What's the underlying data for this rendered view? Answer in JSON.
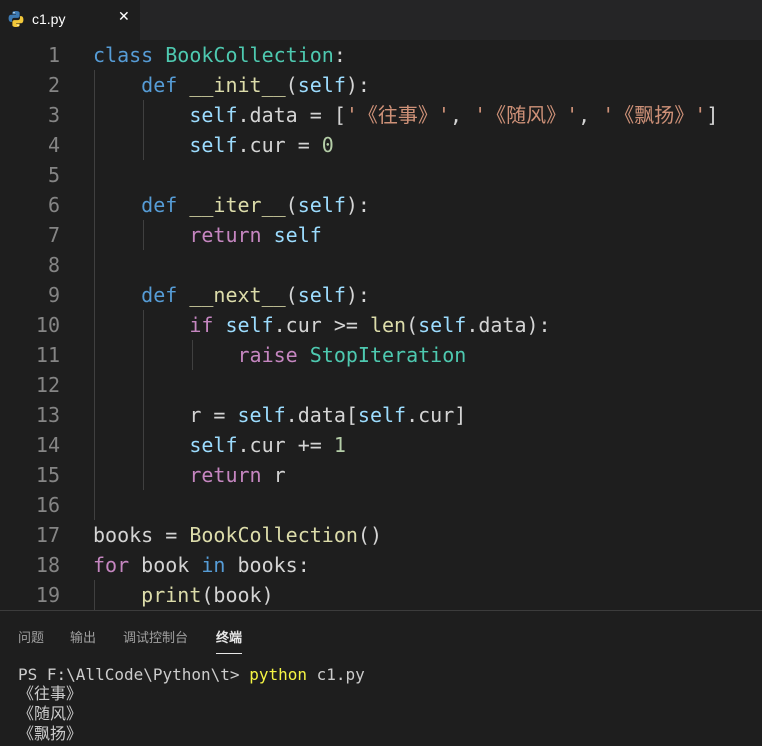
{
  "tab": {
    "filename": "c1.py",
    "close_glyph": "✕",
    "icon": "python-icon"
  },
  "editor": {
    "lines": [
      {
        "n": "1",
        "tokens": [
          [
            "kw",
            "class"
          ],
          [
            "txt",
            " "
          ],
          [
            "cls",
            "BookCollection"
          ],
          [
            "txt",
            ":"
          ]
        ]
      },
      {
        "n": "2",
        "tokens": [
          [
            "txt",
            "    "
          ],
          [
            "kw",
            "def"
          ],
          [
            "txt",
            " "
          ],
          [
            "fn",
            "__init__"
          ],
          [
            "txt",
            "("
          ],
          [
            "var",
            "self"
          ],
          [
            "txt",
            "):"
          ]
        ]
      },
      {
        "n": "3",
        "tokens": [
          [
            "txt",
            "        "
          ],
          [
            "var",
            "self"
          ],
          [
            "txt",
            ".data = ["
          ],
          [
            "str",
            "'《往事》'"
          ],
          [
            "txt",
            ", "
          ],
          [
            "str",
            "'《随风》'"
          ],
          [
            "txt",
            ", "
          ],
          [
            "str",
            "'《飘扬》'"
          ],
          [
            "txt",
            "]"
          ]
        ]
      },
      {
        "n": "4",
        "tokens": [
          [
            "txt",
            "        "
          ],
          [
            "var",
            "self"
          ],
          [
            "txt",
            ".cur = "
          ],
          [
            "num",
            "0"
          ]
        ]
      },
      {
        "n": "5",
        "tokens": []
      },
      {
        "n": "6",
        "tokens": [
          [
            "txt",
            "    "
          ],
          [
            "kw",
            "def"
          ],
          [
            "txt",
            " "
          ],
          [
            "fn",
            "__iter__"
          ],
          [
            "txt",
            "("
          ],
          [
            "var",
            "self"
          ],
          [
            "txt",
            "):"
          ]
        ]
      },
      {
        "n": "7",
        "tokens": [
          [
            "txt",
            "        "
          ],
          [
            "ctl",
            "return"
          ],
          [
            "txt",
            " "
          ],
          [
            "var",
            "self"
          ]
        ]
      },
      {
        "n": "8",
        "tokens": []
      },
      {
        "n": "9",
        "tokens": [
          [
            "txt",
            "    "
          ],
          [
            "kw",
            "def"
          ],
          [
            "txt",
            " "
          ],
          [
            "fn",
            "__next__"
          ],
          [
            "txt",
            "("
          ],
          [
            "var",
            "self"
          ],
          [
            "txt",
            "):"
          ]
        ]
      },
      {
        "n": "10",
        "tokens": [
          [
            "txt",
            "        "
          ],
          [
            "ctl",
            "if"
          ],
          [
            "txt",
            " "
          ],
          [
            "var",
            "self"
          ],
          [
            "txt",
            ".cur >= "
          ],
          [
            "fn",
            "len"
          ],
          [
            "txt",
            "("
          ],
          [
            "var",
            "self"
          ],
          [
            "txt",
            ".data):"
          ]
        ]
      },
      {
        "n": "11",
        "tokens": [
          [
            "txt",
            "            "
          ],
          [
            "ctl",
            "raise"
          ],
          [
            "txt",
            " "
          ],
          [
            "cls",
            "StopIteration"
          ]
        ]
      },
      {
        "n": "12",
        "tokens": []
      },
      {
        "n": "13",
        "tokens": [
          [
            "txt",
            "        r = "
          ],
          [
            "var",
            "self"
          ],
          [
            "txt",
            ".data["
          ],
          [
            "var",
            "self"
          ],
          [
            "txt",
            ".cur]"
          ]
        ]
      },
      {
        "n": "14",
        "tokens": [
          [
            "txt",
            "        "
          ],
          [
            "var",
            "self"
          ],
          [
            "txt",
            ".cur += "
          ],
          [
            "num",
            "1"
          ]
        ]
      },
      {
        "n": "15",
        "tokens": [
          [
            "txt",
            "        "
          ],
          [
            "ctl",
            "return"
          ],
          [
            "txt",
            " r"
          ]
        ]
      },
      {
        "n": "16",
        "tokens": []
      },
      {
        "n": "17",
        "tokens": [
          [
            "txt",
            "books = "
          ],
          [
            "fn",
            "BookCollection"
          ],
          [
            "txt",
            "()"
          ]
        ]
      },
      {
        "n": "18",
        "tokens": [
          [
            "ctl",
            "for"
          ],
          [
            "txt",
            " book "
          ],
          [
            "kw",
            "in"
          ],
          [
            "txt",
            " books:"
          ]
        ]
      },
      {
        "n": "19",
        "tokens": [
          [
            "txt",
            "    "
          ],
          [
            "fn",
            "print"
          ],
          [
            "txt",
            "(book)"
          ]
        ]
      }
    ]
  },
  "panel": {
    "tabs": [
      "问题",
      "输出",
      "调试控制台",
      "终端"
    ],
    "active_tab": "终端",
    "terminal": {
      "prompt": "PS F:\\AllCode\\Python\\t> ",
      "command": "python",
      "args": " c1.py",
      "output": [
        "《往事》",
        "《随风》",
        "《飘扬》"
      ]
    }
  }
}
